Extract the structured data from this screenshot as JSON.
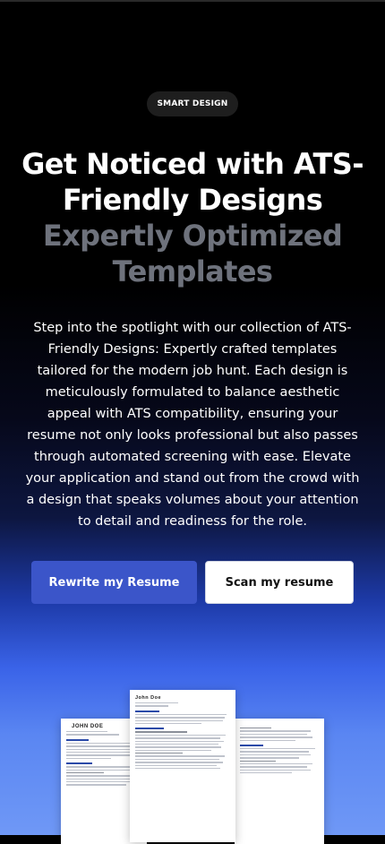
{
  "badge": "SMART DESIGN",
  "heading": {
    "line1": "Get Noticed with ATS-",
    "line2": "Friendly Designs",
    "line3": "Expertly Optimized",
    "line4": "Templates"
  },
  "description": "Step into the spotlight with our collection of ATS-Friendly Designs: Expertly crafted templates tailored for the modern job hunt. Each design is meticulously formulated to balance aesthetic appeal with ATS compatibility, ensuring your resume not only looks professional but also passes through automated screening with ease. Elevate your application and stand out from the crowd with a design that speaks volumes about your attention to detail and readiness for the role.",
  "buttons": {
    "rewrite": "Rewrite my Resume",
    "scan": "Scan my resume"
  },
  "previews": {
    "left_name": "JOHN DOE",
    "center_name": "John Doe"
  },
  "colors": {
    "primary_button": "#3b55c9",
    "heading_muted": "#6e727c"
  }
}
